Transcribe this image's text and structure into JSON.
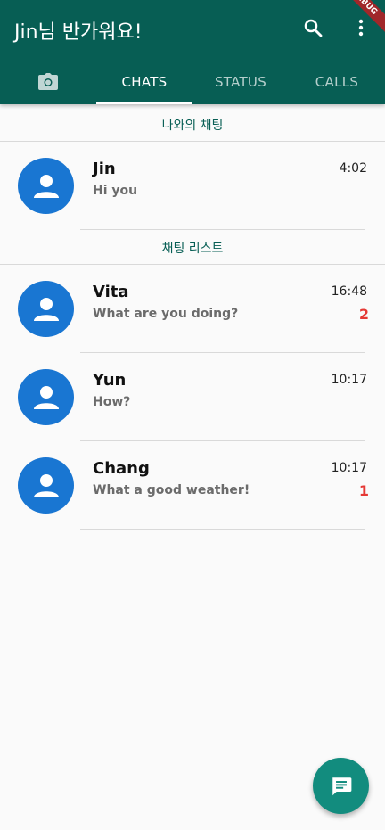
{
  "appbar": {
    "title": "Jin님 반가워요!",
    "debug_label": "DEBUG",
    "tabs": [
      {
        "label": "",
        "icon": "camera-icon"
      },
      {
        "label": "CHATS"
      },
      {
        "label": "STATUS"
      },
      {
        "label": "CALLS"
      }
    ],
    "active_tab": "CHATS"
  },
  "sections": {
    "my_chat": "나와의 채팅",
    "chat_list": "채팅 리스트"
  },
  "my_chat": {
    "name": "Jin",
    "message": "Hi you",
    "time": "4:02"
  },
  "chats": [
    {
      "name": "Vita",
      "message": "What are you doing?",
      "time": "16:48",
      "unread": "2"
    },
    {
      "name": "Yun",
      "message": "How?",
      "time": "10:17",
      "unread": ""
    },
    {
      "name": "Chang",
      "message": "What a good weather!",
      "time": "10:17",
      "unread": "1"
    }
  ],
  "colors": {
    "appbar": "#075e54",
    "avatar": "#1976d2",
    "fab": "#128c7e",
    "badge": "#e53935"
  }
}
